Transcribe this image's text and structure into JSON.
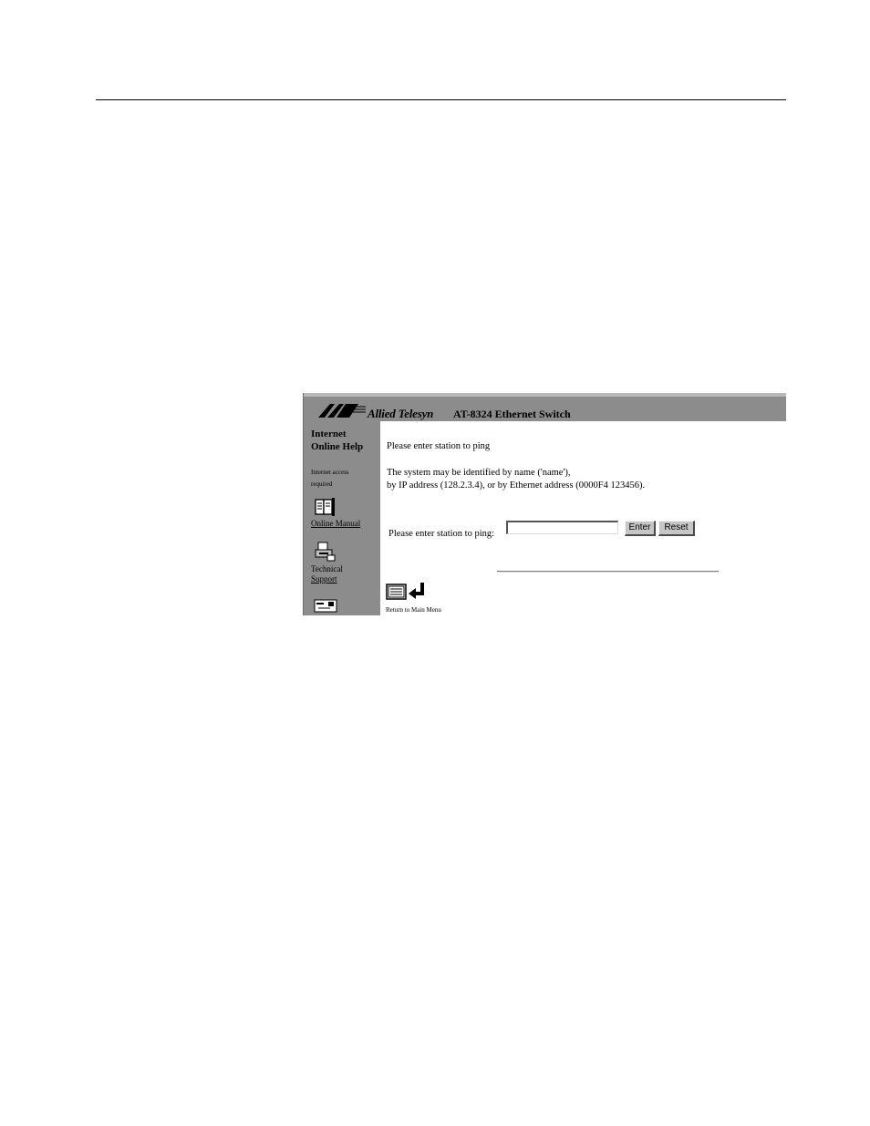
{
  "browser": {
    "banner": {
      "brand": "Allied Telesyn",
      "product": "AT-8324 Ethernet Switch",
      "logo_icon": "allied-telesyn-logo"
    },
    "sidebar": {
      "title_line1": "Internet",
      "title_line2": "Online Help",
      "note_line1": "Internet access",
      "note_line2": "required",
      "items": [
        {
          "label": "Online Manual",
          "icon": "book-icon"
        },
        {
          "label_line1": "Technical",
          "label_line2": "Support",
          "icon": "printer-icon"
        },
        {
          "icon": "envelope-icon"
        }
      ]
    },
    "main": {
      "heading": "Please enter station to ping",
      "description_line1": "The system may be identified by name ('name'),",
      "description_line2": "by IP address (128.2.3.4), or by Ethernet address (0000F4 123456).",
      "form": {
        "label": "Please enter station to ping:",
        "input_value": "",
        "enter_label": "Enter",
        "reset_label": "Reset"
      },
      "return_label": "Return to Main Menu"
    }
  }
}
